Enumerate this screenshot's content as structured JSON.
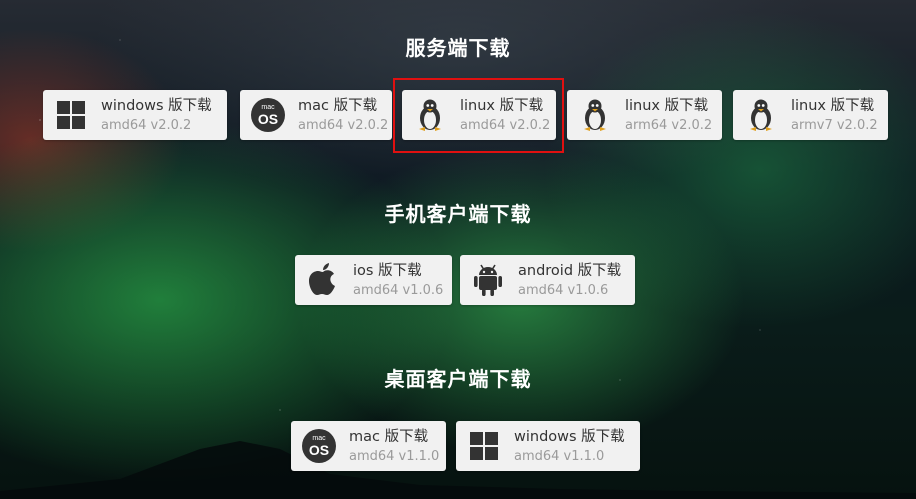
{
  "sections": [
    {
      "title": "服务端下载",
      "buttons": [
        {
          "icon": "windows-icon",
          "name": "windows 版下载",
          "version": "amd64 v2.0.2"
        },
        {
          "icon": "macos-icon",
          "name": "mac 版下载",
          "version": "amd64 v2.0.2"
        },
        {
          "icon": "linux-icon",
          "name": "linux 版下载",
          "version": "amd64 v2.0.2"
        },
        {
          "icon": "linux-icon",
          "name": "linux 版下载",
          "version": "arm64 v2.0.2"
        },
        {
          "icon": "linux-icon",
          "name": "linux 版下载",
          "version": "armv7 v2.0.2"
        }
      ]
    },
    {
      "title": "手机客户端下载",
      "buttons": [
        {
          "icon": "apple-icon",
          "name": "ios 版下载",
          "version": "amd64 v1.0.6"
        },
        {
          "icon": "android-icon",
          "name": "android 版下载",
          "version": "amd64 v1.0.6"
        }
      ]
    },
    {
      "title": "桌面客户端下载",
      "buttons": [
        {
          "icon": "macos-icon",
          "name": "mac 版下载",
          "version": "amd64 v1.1.0"
        },
        {
          "icon": "windows-icon",
          "name": "windows 版下载",
          "version": "amd64 v1.1.0"
        }
      ]
    }
  ],
  "mac_badge": {
    "small": "mac",
    "big": "OS"
  },
  "colors": {
    "highlight": "#e01010",
    "button_bg": "#f1f1f1",
    "title": "#ffffff"
  }
}
